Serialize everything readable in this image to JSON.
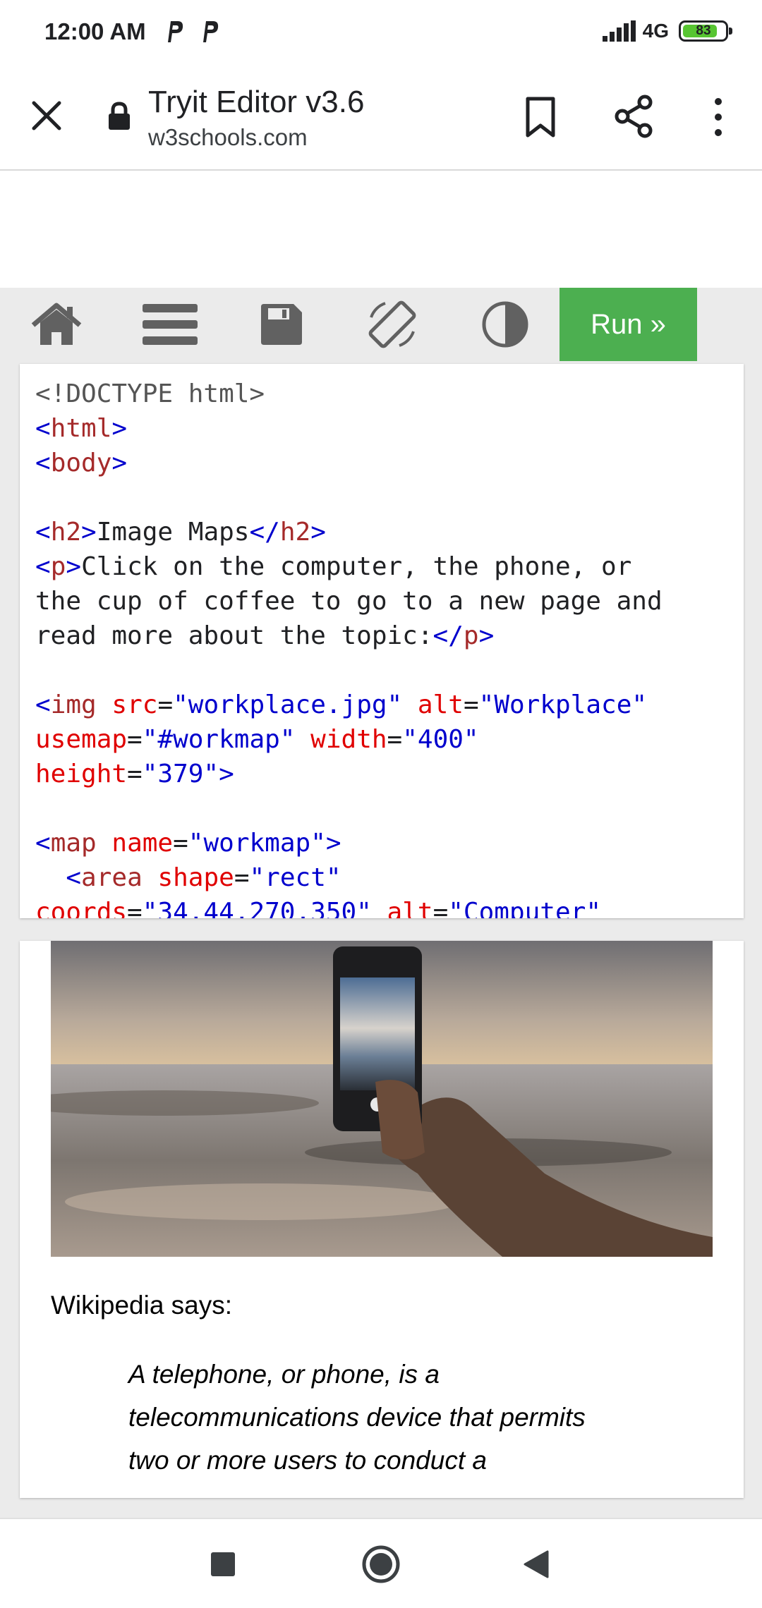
{
  "status_bar": {
    "time": "12:00 AM",
    "notif_icons": [
      "parking-icon",
      "parking-icon"
    ],
    "network": "4G",
    "battery": "83",
    "battery_level": 0.83
  },
  "browser": {
    "title": "Tryit Editor v3.6",
    "url": "w3schools.com",
    "close_icon": "close-icon",
    "lock_icon": "lock-icon",
    "bookmark_icon": "bookmark-icon",
    "share_icon": "share-icon",
    "more_icon": "more-vert-icon"
  },
  "toolbar": {
    "icons": [
      "home-icon",
      "menu-icon",
      "save-icon",
      "rotate-icon",
      "contrast-icon"
    ],
    "run_label": "Run »",
    "run_color": "#4caf50"
  },
  "code": {
    "lines": [
      "<!DOCTYPE html>",
      "<html>",
      "<body>",
      "",
      "<h2>Image Maps</h2>",
      "<p>Click on the computer, the phone, or",
      "the cup of coffee to go to a new page and",
      "read more about the topic:</p>",
      "",
      "<img src=\"workplace.jpg\" alt=\"Workplace\"",
      "usemap=\"#workmap\" width=\"400\"",
      "height=\"379\">",
      "",
      "<map name=\"workmap\">",
      "  <area shape=\"rect\"",
      "coords=\"34,44,270,350\" alt=\"Computer\""
    ]
  },
  "result": {
    "wiki_says": "Wikipedia says:",
    "quote_lines": [
      "A telephone, or phone, is a",
      "telecommunications device that permits",
      "two or more users to conduct a"
    ]
  },
  "nav": {
    "icons": [
      "recents-icon",
      "home-circle-icon",
      "back-icon"
    ]
  }
}
